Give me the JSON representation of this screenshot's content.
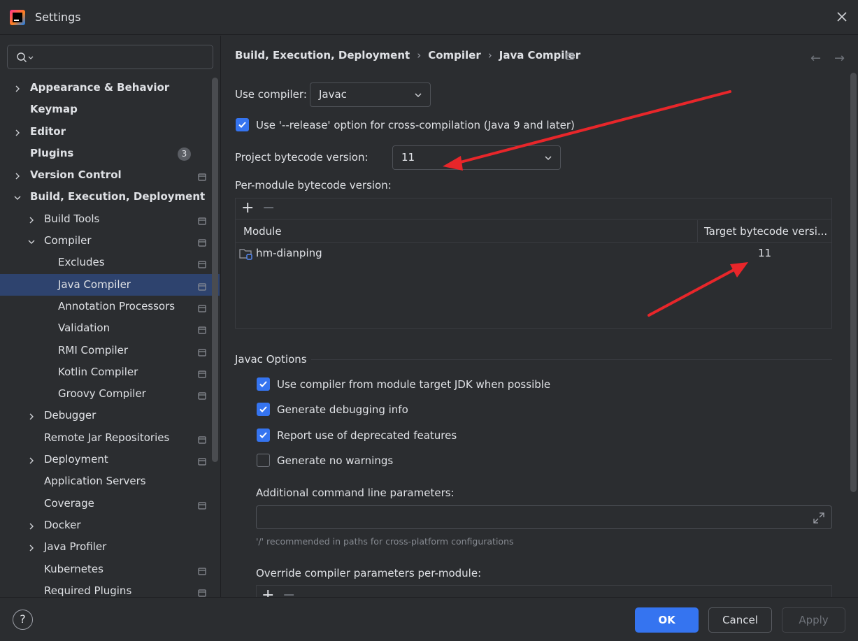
{
  "window": {
    "title": "Settings"
  },
  "search": {
    "placeholder": "",
    "value": ""
  },
  "sidebar": {
    "items": [
      {
        "label": "Appearance & Behavior",
        "bold": true,
        "indent": 0,
        "chevron": "right",
        "pin": false
      },
      {
        "label": "Keymap",
        "bold": true,
        "indent": 0,
        "chevron": "none",
        "pin": false
      },
      {
        "label": "Editor",
        "bold": true,
        "indent": 0,
        "chevron": "right",
        "pin": false
      },
      {
        "label": "Plugins",
        "bold": true,
        "indent": 0,
        "chevron": "none",
        "pin": false,
        "badge": "3"
      },
      {
        "label": "Version Control",
        "bold": true,
        "indent": 0,
        "chevron": "right",
        "pin": true
      },
      {
        "label": "Build, Execution, Deployment",
        "bold": true,
        "indent": 0,
        "chevron": "down",
        "pin": false
      },
      {
        "label": "Build Tools",
        "bold": false,
        "indent": 1,
        "chevron": "right",
        "pin": true
      },
      {
        "label": "Compiler",
        "bold": false,
        "indent": 1,
        "chevron": "down",
        "pin": true
      },
      {
        "label": "Excludes",
        "bold": false,
        "indent": 2,
        "chevron": "none",
        "pin": true
      },
      {
        "label": "Java Compiler",
        "bold": false,
        "indent": 2,
        "chevron": "none",
        "pin": true,
        "selected": true
      },
      {
        "label": "Annotation Processors",
        "bold": false,
        "indent": 2,
        "chevron": "none",
        "pin": true
      },
      {
        "label": "Validation",
        "bold": false,
        "indent": 2,
        "chevron": "none",
        "pin": true
      },
      {
        "label": "RMI Compiler",
        "bold": false,
        "indent": 2,
        "chevron": "none",
        "pin": true
      },
      {
        "label": "Kotlin Compiler",
        "bold": false,
        "indent": 2,
        "chevron": "none",
        "pin": true
      },
      {
        "label": "Groovy Compiler",
        "bold": false,
        "indent": 2,
        "chevron": "none",
        "pin": true
      },
      {
        "label": "Debugger",
        "bold": false,
        "indent": 1,
        "chevron": "right",
        "pin": false
      },
      {
        "label": "Remote Jar Repositories",
        "bold": false,
        "indent": 1,
        "chevron": "none",
        "pin": true
      },
      {
        "label": "Deployment",
        "bold": false,
        "indent": 1,
        "chevron": "right",
        "pin": true
      },
      {
        "label": "Application Servers",
        "bold": false,
        "indent": 1,
        "chevron": "none",
        "pin": false
      },
      {
        "label": "Coverage",
        "bold": false,
        "indent": 1,
        "chevron": "none",
        "pin": true
      },
      {
        "label": "Docker",
        "bold": false,
        "indent": 1,
        "chevron": "right",
        "pin": false
      },
      {
        "label": "Java Profiler",
        "bold": false,
        "indent": 1,
        "chevron": "right",
        "pin": false
      },
      {
        "label": "Kubernetes",
        "bold": false,
        "indent": 1,
        "chevron": "none",
        "pin": true
      },
      {
        "label": "Required Plugins",
        "bold": false,
        "indent": 1,
        "chevron": "none",
        "pin": true
      }
    ]
  },
  "breadcrumb": {
    "part1": "Build, Execution, Deployment",
    "sep": "›",
    "part2": "Compiler",
    "part3": "Java Compiler"
  },
  "nav": {
    "back": "←",
    "forward": "→"
  },
  "compiler": {
    "use_compiler_label": "Use compiler:",
    "use_compiler_value": "Javac",
    "release_option_label": "Use '--release' option for cross-compilation (Java 9 and later)",
    "release_option_checked": true,
    "project_bytecode_label": "Project bytecode version:",
    "project_bytecode_value": "11",
    "per_module_label": "Per-module bytecode version:"
  },
  "module_table": {
    "add": "+",
    "remove": "−",
    "columns": [
      "Module",
      "Target bytecode versi..."
    ],
    "rows": [
      {
        "module": "hm-dianping",
        "target": "11"
      }
    ]
  },
  "javac_options": {
    "title": "Javac Options",
    "options": [
      {
        "label": "Use compiler from module target JDK when possible",
        "checked": true
      },
      {
        "label": "Generate debugging info",
        "checked": true
      },
      {
        "label": "Report use of deprecated features",
        "checked": true
      },
      {
        "label": "Generate no warnings",
        "checked": false
      }
    ],
    "additional_params_label": "Additional command line parameters:",
    "additional_params_value": "",
    "hint": "'/' recommended in paths for cross-platform configurations",
    "override_label": "Override compiler parameters per-module:"
  },
  "footer": {
    "help": "?",
    "ok": "OK",
    "cancel": "Cancel",
    "apply": "Apply"
  },
  "colors": {
    "accent": "#3574f0",
    "selection": "#2e436e",
    "annotation_arrow": "#e8262a",
    "background": "#2b2d30"
  }
}
